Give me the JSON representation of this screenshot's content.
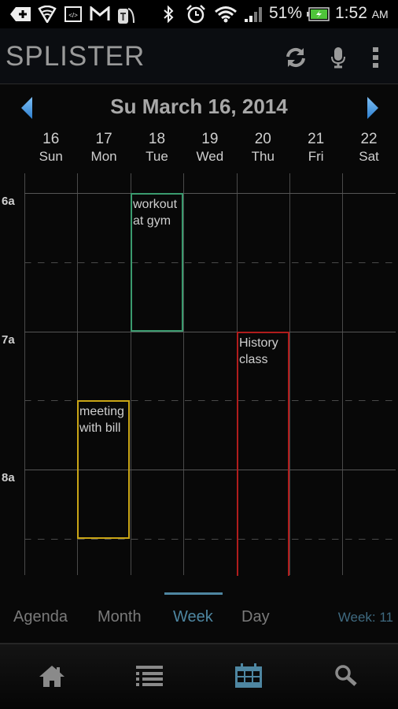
{
  "status_bar": {
    "icons": [
      "notification-add-icon",
      "vpn-shield-wifi-icon",
      "developer-code-icon",
      "gmail-icon",
      "t-mobile-icon",
      "bluetooth-icon",
      "alarm-icon",
      "wifi-icon",
      "cell-signal-icon",
      "battery-charging-icon"
    ],
    "battery_percent": "51%",
    "time": "1:52",
    "ampm": "AM"
  },
  "action_bar": {
    "title": "SPLISTER",
    "actions": [
      {
        "name": "sync",
        "icon": "sync-icon"
      },
      {
        "name": "voice",
        "icon": "microphone-icon"
      },
      {
        "name": "overflow",
        "icon": "more-vertical-icon"
      }
    ]
  },
  "date_nav": {
    "title": "Su March 16, 2014",
    "prev_icon": "arrow-left-icon",
    "next_icon": "arrow-right-icon"
  },
  "week": {
    "days": [
      {
        "num": "16",
        "name": "Sun"
      },
      {
        "num": "17",
        "name": "Mon"
      },
      {
        "num": "18",
        "name": "Tue"
      },
      {
        "num": "19",
        "name": "Wed"
      },
      {
        "num": "20",
        "name": "Thu"
      },
      {
        "num": "21",
        "name": "Fri"
      },
      {
        "num": "22",
        "name": "Sat"
      }
    ],
    "hours": [
      "6a",
      "7a",
      "8a"
    ],
    "events": [
      {
        "title": "workout\nat gym",
        "day_index": 2,
        "start_hour": 6.0,
        "end_hour": 7.0,
        "color": "#3a9a6e"
      },
      {
        "title": "History\nclass",
        "day_index": 4,
        "start_hour": 7.0,
        "end_hour": 9.0,
        "color": "#b01c1c"
      },
      {
        "title": "meeting\nwith bill",
        "day_index": 1,
        "start_hour": 7.5,
        "end_hour": 8.5,
        "color": "#c9a516"
      }
    ]
  },
  "view_tabs": {
    "items": [
      {
        "label": "Agenda",
        "active": false
      },
      {
        "label": "Month",
        "active": false
      },
      {
        "label": "Week",
        "active": true
      },
      {
        "label": "Day",
        "active": false
      }
    ],
    "week_number": "Week: 11",
    "accent_color": "#4e86a1"
  },
  "bottom_nav": {
    "items": [
      {
        "name": "home",
        "icon": "home-icon",
        "active": false
      },
      {
        "name": "list",
        "icon": "list-icon",
        "active": false
      },
      {
        "name": "calendar",
        "icon": "calendar-icon",
        "active": true
      },
      {
        "name": "search",
        "icon": "search-icon",
        "active": false
      }
    ]
  }
}
